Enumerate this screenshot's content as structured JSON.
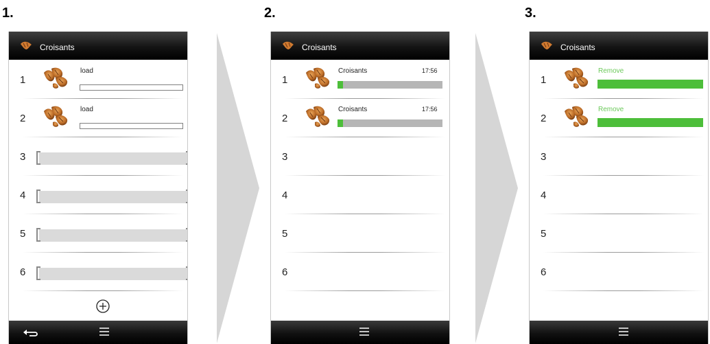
{
  "steps": [
    {
      "label": "1.",
      "title": "Croisants",
      "slots": [
        {
          "num": "1",
          "text": "load"
        },
        {
          "num": "2",
          "text": "load"
        },
        {
          "num": "3"
        },
        {
          "num": "4"
        },
        {
          "num": "5"
        },
        {
          "num": "6"
        }
      ],
      "icons": [
        "croissant-icon",
        "plus-icon",
        "back-icon",
        "menu-icon"
      ]
    },
    {
      "label": "2.",
      "title": "Croisants",
      "slots": [
        {
          "num": "1",
          "text": "Croisants",
          "time": "17:56",
          "progress": 0.05
        },
        {
          "num": "2",
          "text": "Croisants",
          "time": "17:56",
          "progress": 0.05
        },
        {
          "num": "3"
        },
        {
          "num": "4"
        },
        {
          "num": "5"
        },
        {
          "num": "6"
        }
      ],
      "icons": [
        "croissant-icon",
        "menu-icon"
      ]
    },
    {
      "label": "3.",
      "title": "Croisants",
      "slots": [
        {
          "num": "1",
          "text": "Remove",
          "progress": 1.0
        },
        {
          "num": "2",
          "text": "Remove",
          "progress": 1.0
        },
        {
          "num": "3"
        },
        {
          "num": "4"
        },
        {
          "num": "5"
        },
        {
          "num": "6"
        }
      ],
      "icons": [
        "croissant-icon",
        "menu-icon"
      ]
    }
  ],
  "colors": {
    "progress_green": "#4dbe3a",
    "remove_text": "#6cc95b",
    "bar_dark": "#000000"
  }
}
